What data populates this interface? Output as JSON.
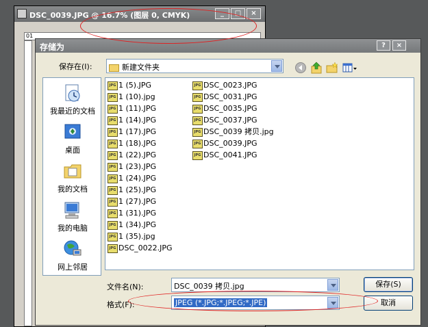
{
  "bg_window": {
    "title": "DSC_0039.JPG @ 16.7% (图层 0, CMYK)",
    "minimize": "_",
    "maximize": "□",
    "close": "×",
    "ruler_mark": "01"
  },
  "dialog": {
    "title": "存储为",
    "help": "?",
    "close": "×",
    "save_in_label": "保存在(I):",
    "save_in_value": "新建文件夹",
    "places": [
      {
        "label": "我最近的文档",
        "icon": "recent-documents-icon"
      },
      {
        "label": "桌面",
        "icon": "desktop-icon"
      },
      {
        "label": "我的文档",
        "icon": "my-documents-icon"
      },
      {
        "label": "我的电脑",
        "icon": "my-computer-icon"
      },
      {
        "label": "网上邻居",
        "icon": "network-places-icon"
      }
    ],
    "files_col1": [
      "1 (5).JPG",
      "1 (10).jpg",
      "1 (11).JPG",
      "1 (14).JPG",
      "1 (17).JPG",
      "1 (18).JPG",
      "1 (22).JPG",
      "1 (23).JPG",
      "1 (24).JPG",
      "1 (25).JPG",
      "1 (27).JPG",
      "1 (31).JPG",
      "1 (34).JPG",
      "1 (35).jpg",
      "DSC_0022.JPG"
    ],
    "files_col2": [
      "DSC_0023.JPG",
      "DSC_0031.JPG",
      "DSC_0035.JPG",
      "DSC_0037.JPG",
      "DSC_0039 拷贝.jpg",
      "DSC_0039.JPG",
      "DSC_0041.JPG"
    ],
    "file_icon_text": "JPG",
    "filename_label": "文件名(N):",
    "filename_value": "DSC_0039 拷贝.jpg",
    "format_label": "格式(F):",
    "format_value": "JPEG (*.JPG;*.JPEG;*.JPE)",
    "save_button": "保存(S)",
    "cancel_button": "取消"
  }
}
